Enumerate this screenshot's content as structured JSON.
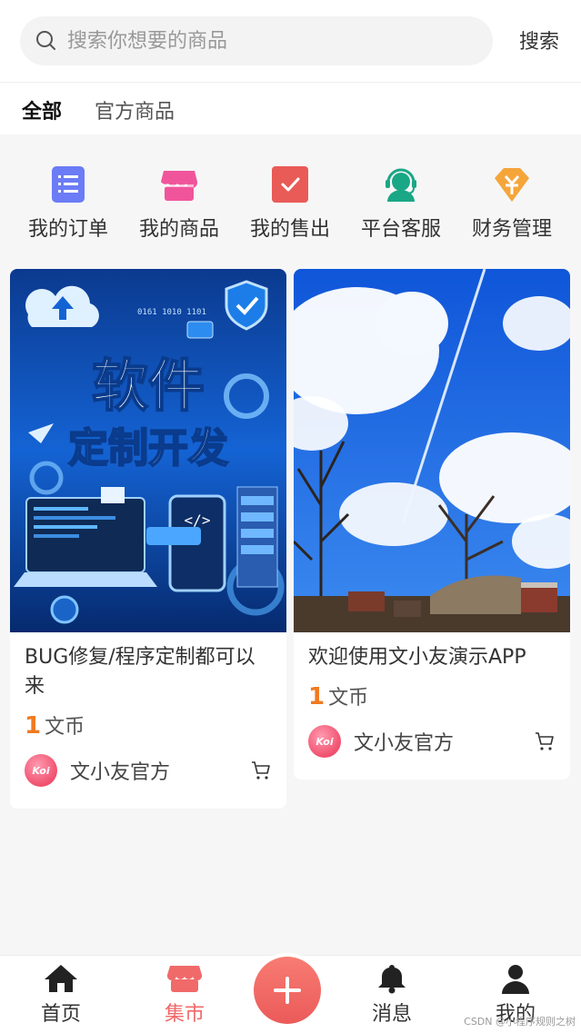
{
  "search": {
    "placeholder": "搜索你想要的商品",
    "button_label": "搜索"
  },
  "tabs": [
    {
      "label": "全部",
      "active": true
    },
    {
      "label": "官方商品",
      "active": false
    }
  ],
  "menu": [
    {
      "label": "我的订单",
      "icon": "order-list-icon",
      "color": "#6b7cf6"
    },
    {
      "label": "我的商品",
      "icon": "shop-icon",
      "color": "#f0559b"
    },
    {
      "label": "我的售出",
      "icon": "sold-check-icon",
      "color": "#e95b57"
    },
    {
      "label": "平台客服",
      "icon": "customer-service-icon",
      "color": "#1aa786"
    },
    {
      "label": "财务管理",
      "icon": "finance-yuan-icon",
      "color": "#f5a53a"
    }
  ],
  "products": [
    {
      "title": "BUG修复/程序定制都可以来",
      "image_text_line1": "软件",
      "image_text_line2": "定制开发",
      "image_binary": "0161 1010 1101",
      "price": "1",
      "currency": "文币",
      "seller": "文小友官方",
      "avatar_text": "Koi"
    },
    {
      "title": "欢迎使用文小友演示APP",
      "price": "1",
      "currency": "文币",
      "seller": "文小友官方",
      "avatar_text": "Koi"
    }
  ],
  "nav": [
    {
      "label": "首页",
      "icon": "home-icon",
      "active": false
    },
    {
      "label": "集市",
      "icon": "market-icon",
      "active": true
    },
    {
      "label": "消息",
      "icon": "bell-icon",
      "active": false
    },
    {
      "label": "我的",
      "icon": "user-icon",
      "active": false
    }
  ],
  "colors": {
    "accent": "#f06a6a",
    "price": "#f07a22"
  },
  "watermark": "CSDN @小程序规则之树"
}
